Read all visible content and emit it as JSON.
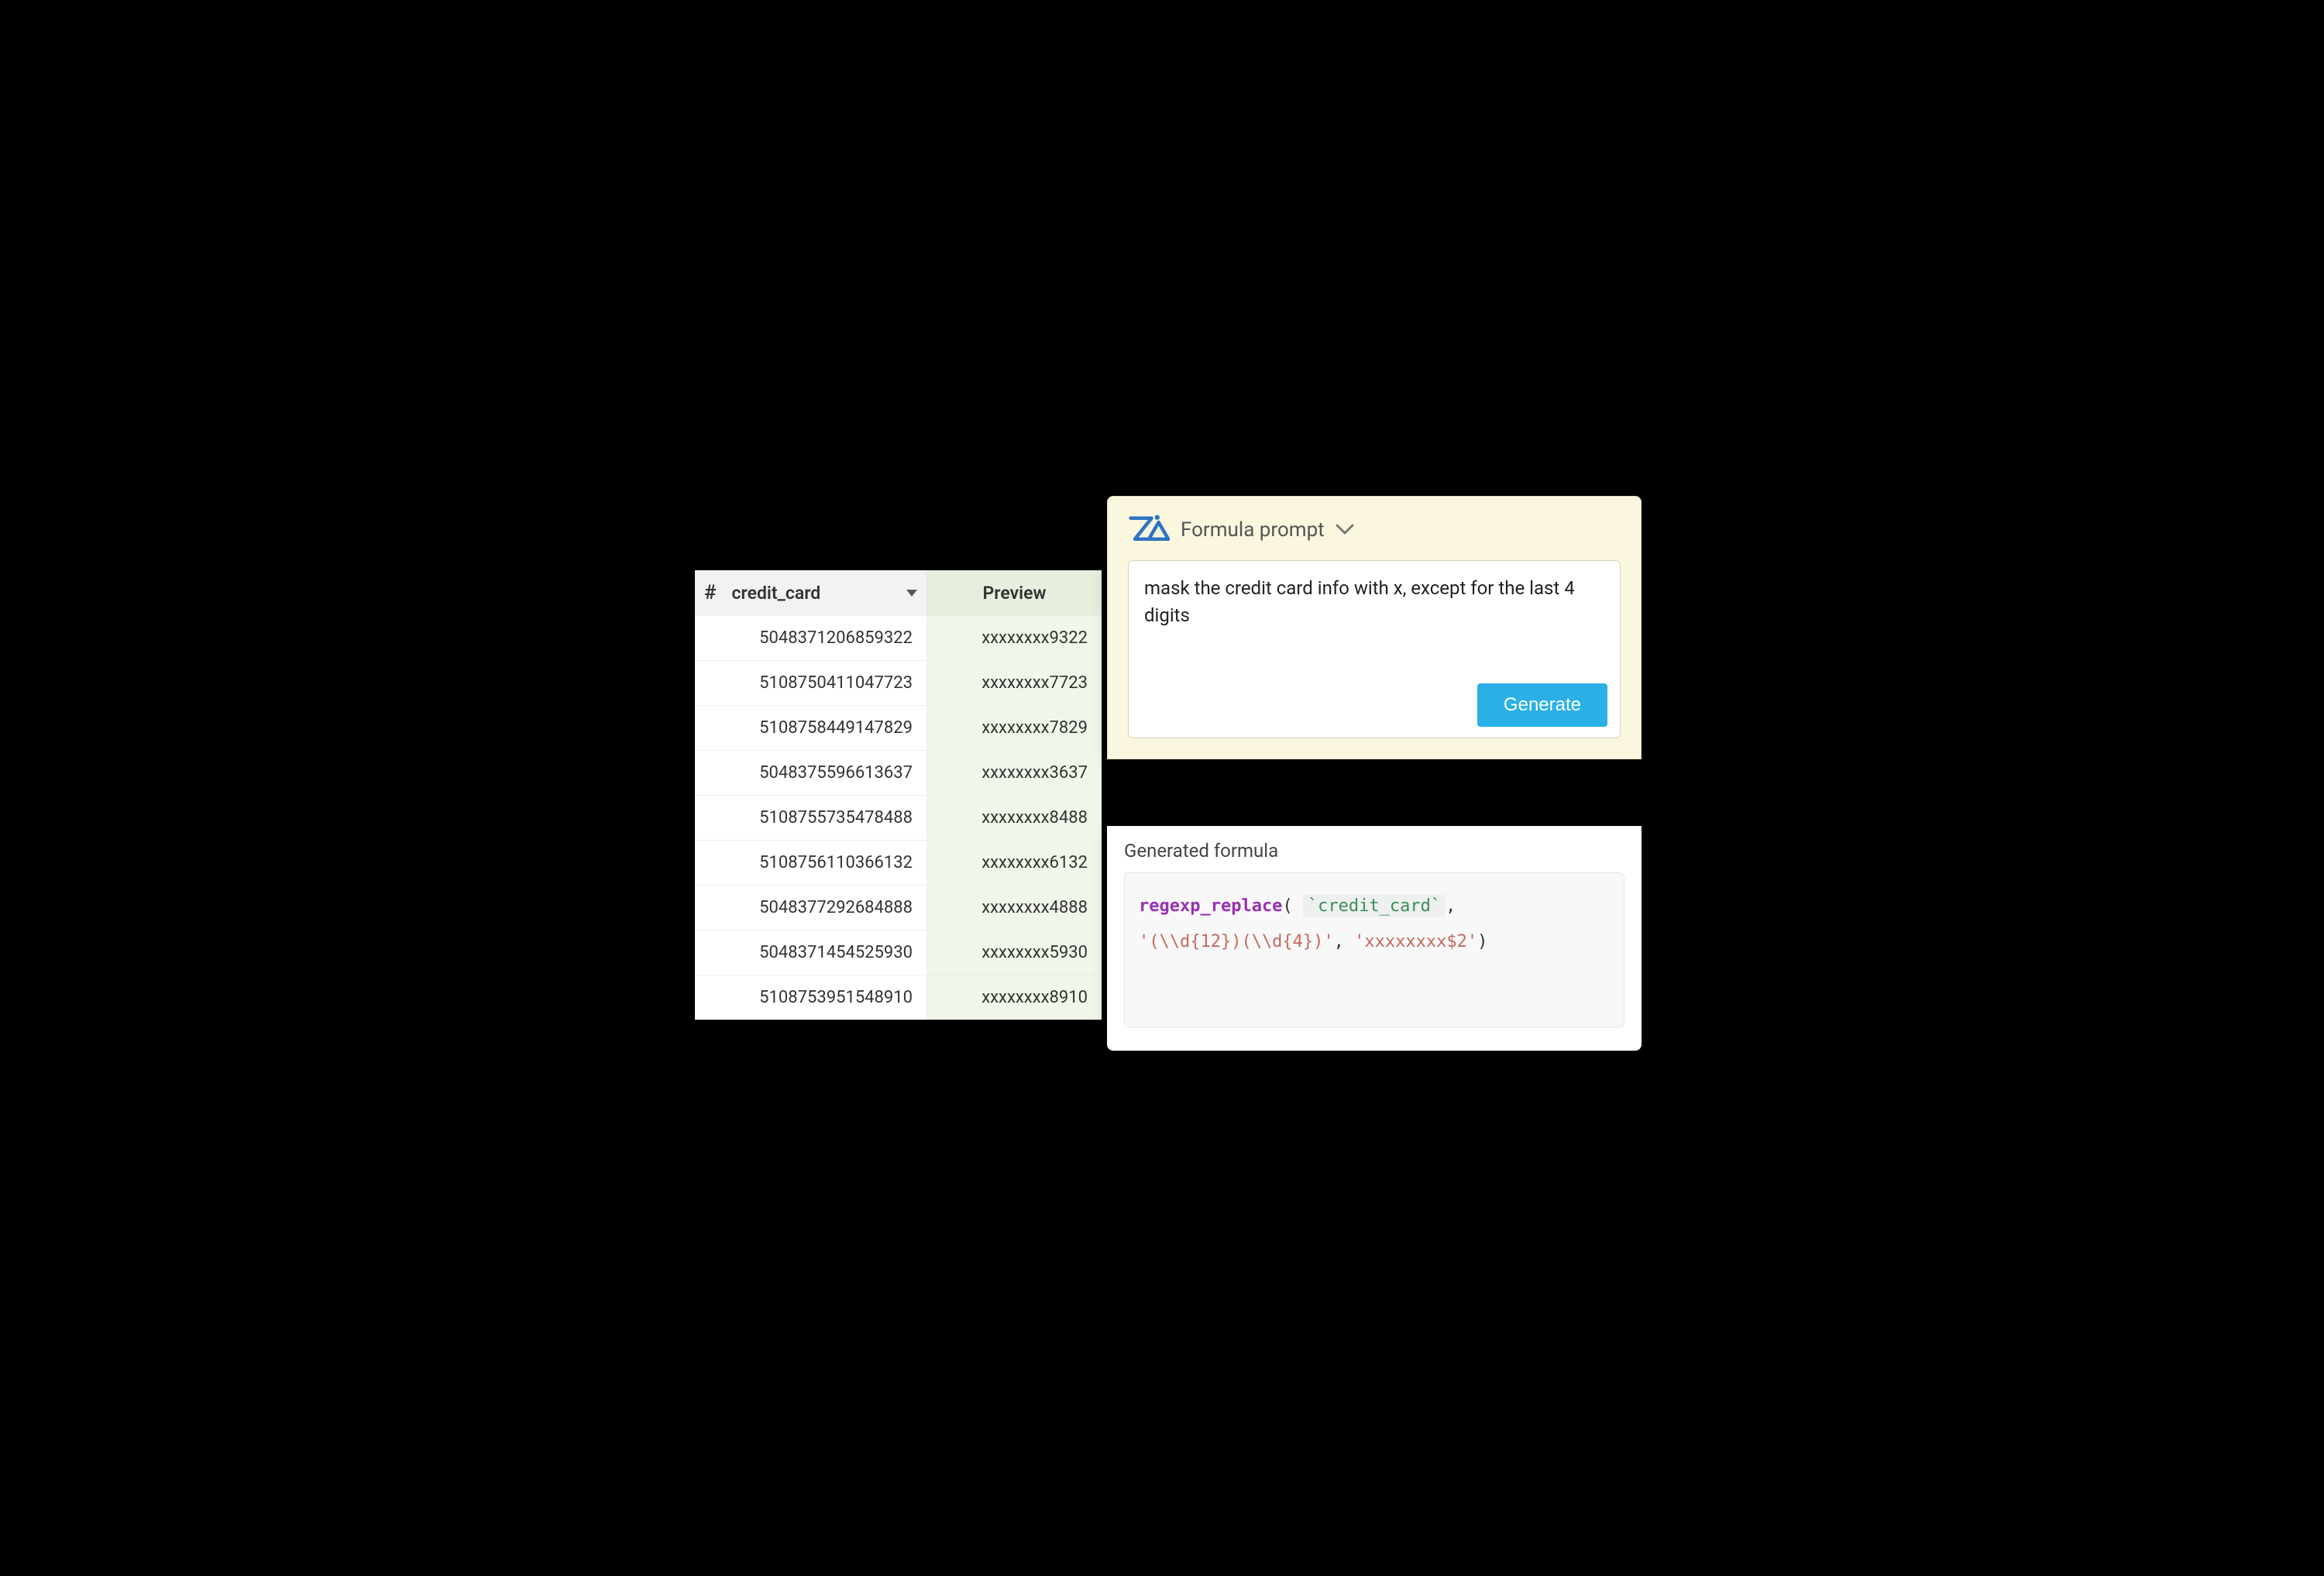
{
  "table": {
    "header": {
      "hash_symbol": "#",
      "cc_label": "credit_card",
      "preview_label": "Preview"
    },
    "rows": [
      {
        "cc": "5048371206859322",
        "preview": "xxxxxxxx9322"
      },
      {
        "cc": "5108750411047723",
        "preview": "xxxxxxxx7723"
      },
      {
        "cc": "5108758449147829",
        "preview": "xxxxxxxx7829"
      },
      {
        "cc": "5048375596613637",
        "preview": "xxxxxxxx3637"
      },
      {
        "cc": "5108755735478488",
        "preview": "xxxxxxxx8488"
      },
      {
        "cc": "5108756110366132",
        "preview": "xxxxxxxx6132"
      },
      {
        "cc": "5048377292684888",
        "preview": "xxxxxxxx4888"
      },
      {
        "cc": "5048371454525930",
        "preview": "xxxxxxxx5930"
      },
      {
        "cc": "5108753951548910",
        "preview": "xxxxxxxx8910"
      }
    ]
  },
  "prompt_panel": {
    "title": "Formula prompt",
    "prompt_text": "mask the credit card info with x, except for the last 4 digits",
    "generate_label": "Generate"
  },
  "formula_panel": {
    "title": "Generated formula",
    "tokens": {
      "fn": "regexp_replace",
      "open": "(",
      "col": "`credit_card`",
      "comma1": ",",
      "arg_regex": "'(\\\\d{12})(\\\\d{4})'",
      "comma2": ", ",
      "arg_repl": "'xxxxxxxx$2'",
      "close": ")"
    }
  },
  "colors": {
    "accent": "#2bb0e6",
    "prompt_bg": "#fbf7df",
    "preview_bg": "#f0f6e9"
  }
}
